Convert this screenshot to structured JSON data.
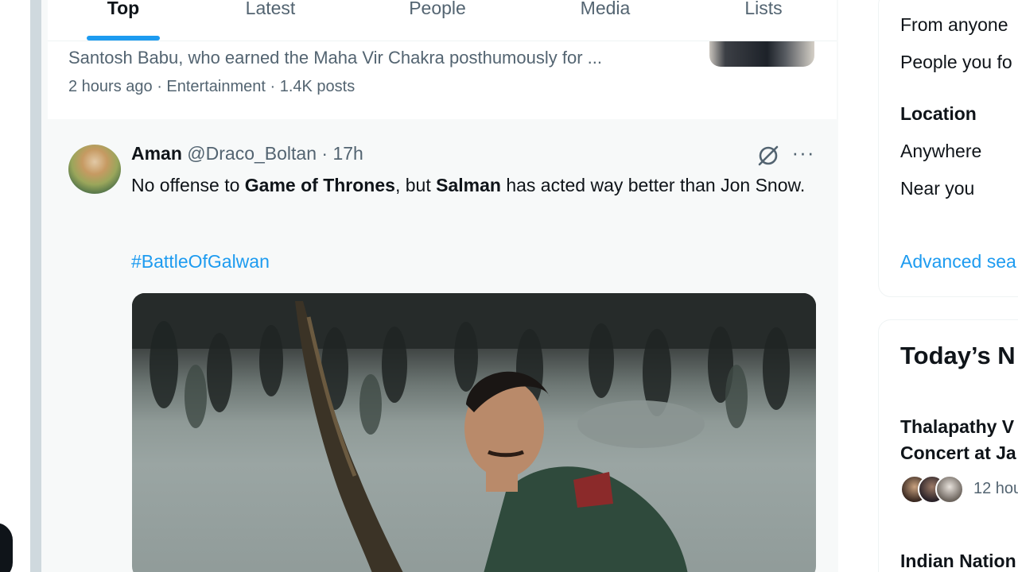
{
  "tabs": [
    "Top",
    "Latest",
    "People",
    "Media",
    "Lists"
  ],
  "active_tab": "Top",
  "trend": {
    "text": "Santosh Babu, who earned the Maha Vir Chakra posthumously for ...",
    "meta": "2 hours ago · Entertainment · 1.4K posts"
  },
  "tweet": {
    "author_name": "Aman",
    "author_handle": "@Draco_Boltan",
    "time": "· 17h",
    "body": {
      "part1": "No offense to ",
      "bold1": "Game of Thrones",
      "part2": ", but ",
      "bold2": "Salman",
      "part3": " has acted way better than Jon Snow."
    },
    "hashtag": "#BattleOfGalwan",
    "more_label": "···"
  },
  "sidebar": {
    "people_from_anyone": "From anyone",
    "people_you_follow": "People you fo",
    "location_heading": "Location",
    "location_anywhere": "Anywhere",
    "location_near": "Near you",
    "advanced_search": "Advanced sea",
    "news_heading": "Today’s N",
    "news1_line1": "Thalapathy V",
    "news1_line2": "Concert at Ja",
    "news1_meta": "12 hou",
    "news2_line1": "Indian Nation"
  },
  "colors": {
    "accent": "#1d9bf0",
    "text": "#0f1419",
    "muted": "#536471"
  }
}
